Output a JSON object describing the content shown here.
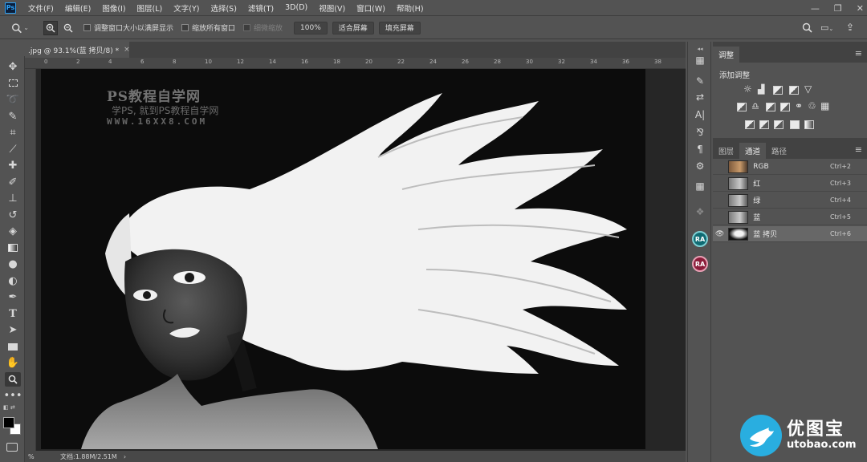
{
  "app": {
    "logo": "Ps"
  },
  "menu": [
    "文件(F)",
    "编辑(E)",
    "图像(I)",
    "图层(L)",
    "文字(Y)",
    "选择(S)",
    "滤镜(T)",
    "3D(D)",
    "视图(V)",
    "窗口(W)",
    "帮助(H)"
  ],
  "window_controls": {
    "minimize": "—",
    "restore": "❐",
    "close": "✕"
  },
  "options": {
    "resize_windows": "调整窗口大小以满屏显示",
    "zoom_all": "缩放所有窗口",
    "scrubby_zoom": "细微缩放",
    "zoom_value": "100%",
    "fit_screen": "适合屏幕",
    "fill_screen": "填充屏幕"
  },
  "document": {
    "tab_title": ".jpg @ 93.1%(蓝 拷贝/8) *",
    "close": "×",
    "status": "文档:1.88M/2.51M",
    "zoom_readout": "%"
  },
  "ruler_numbers": [
    "0",
    "2",
    "4",
    "6",
    "8",
    "10",
    "12",
    "14",
    "16",
    "18",
    "20",
    "22",
    "24",
    "26",
    "28",
    "30",
    "32",
    "34",
    "36",
    "38"
  ],
  "watermark": {
    "title": "PS教程自学网",
    "subtitle": "学PS, 就到PS教程自学网",
    "url": "WWW.16XX8.COM"
  },
  "strip_badges": [
    "RA",
    "RA"
  ],
  "colors": {
    "badge_blue": "#0f6b73",
    "badge_red": "#8b1d3a",
    "brand_blue": "#29aee0"
  },
  "adjustments": {
    "tab": "调整",
    "title": "添加调整"
  },
  "channels": {
    "tabs": [
      "图层",
      "通道",
      "路径"
    ],
    "rows": [
      {
        "name": "RGB",
        "shortcut": "Ctrl+2",
        "eye": ""
      },
      {
        "name": "红",
        "shortcut": "Ctrl+3",
        "eye": ""
      },
      {
        "name": "绿",
        "shortcut": "Ctrl+4",
        "eye": ""
      },
      {
        "name": "蓝",
        "shortcut": "Ctrl+5",
        "eye": ""
      },
      {
        "name": "蓝 拷贝",
        "shortcut": "Ctrl+6",
        "eye": "👁"
      }
    ]
  },
  "brand": {
    "name": "优图宝",
    "url": "utobao.com"
  },
  "icons": [
    "zoom-icon",
    "zoom-in-icon",
    "zoom-out-icon",
    "move-icon",
    "marquee-icon",
    "lasso-icon",
    "quick-select-icon",
    "crop-icon",
    "eyedropper-icon",
    "healing-icon",
    "brush-icon",
    "stamp-icon",
    "history-brush-icon",
    "eraser-icon",
    "gradient-icon",
    "blur-icon",
    "dodge-icon",
    "pen-icon",
    "type-icon",
    "path-select-icon",
    "rectangle-icon",
    "hand-icon",
    "search-icon",
    "workspace-icon",
    "share-icon"
  ]
}
